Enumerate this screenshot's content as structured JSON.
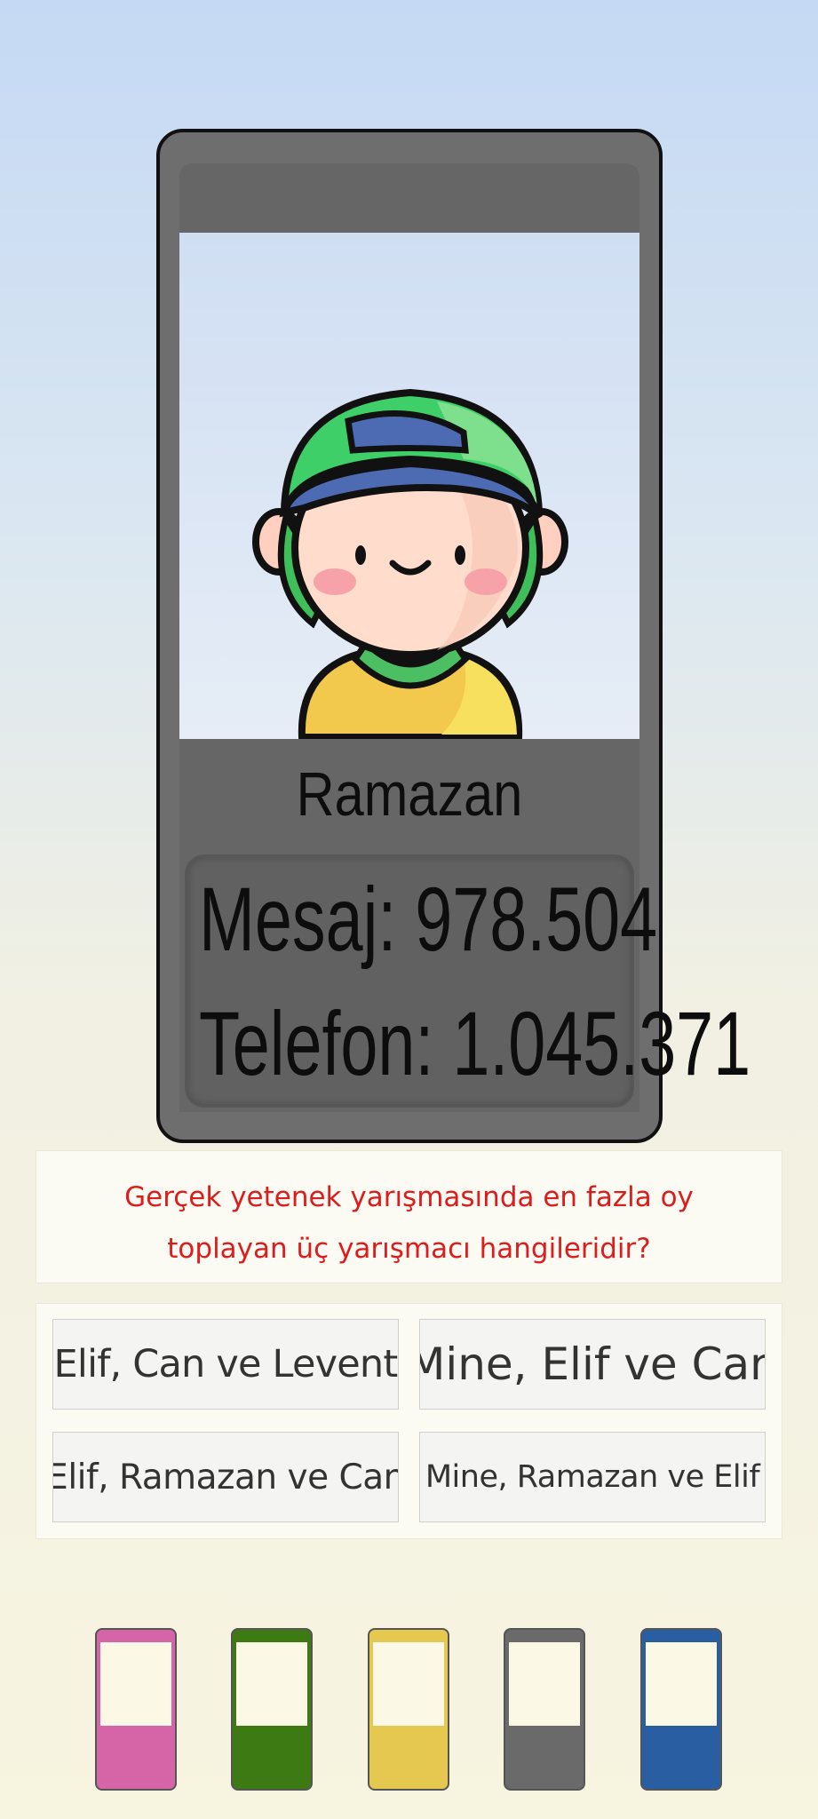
{
  "contestant": {
    "name": "Ramazan",
    "message_line": "Mesaj: 978.504",
    "phone_line": "Telefon: 1.045.371"
  },
  "question": {
    "line1": "Gerçek yetenek yarışmasında en fazla oy",
    "line2": "toplayan üç yarışmacı hangileridir?"
  },
  "answers": [
    {
      "label": "Elif, Can ve Levent"
    },
    {
      "label": "Mine, Elif ve Can"
    },
    {
      "label": "Elif, Ramazan ve Can"
    },
    {
      "label": "Mine, Ramazan ve Elif"
    }
  ],
  "swatches": [
    {
      "name": "pink",
      "color": "#d565a6"
    },
    {
      "name": "green",
      "color": "#3d7a14"
    },
    {
      "name": "yellow",
      "color": "#e4c850"
    },
    {
      "name": "gray",
      "color": "#6a6a6a"
    },
    {
      "name": "blue",
      "color": "#2a5ea3"
    }
  ],
  "colors": {
    "question_text": "#dd1c1c",
    "phone_body": "#6e6e6e"
  }
}
